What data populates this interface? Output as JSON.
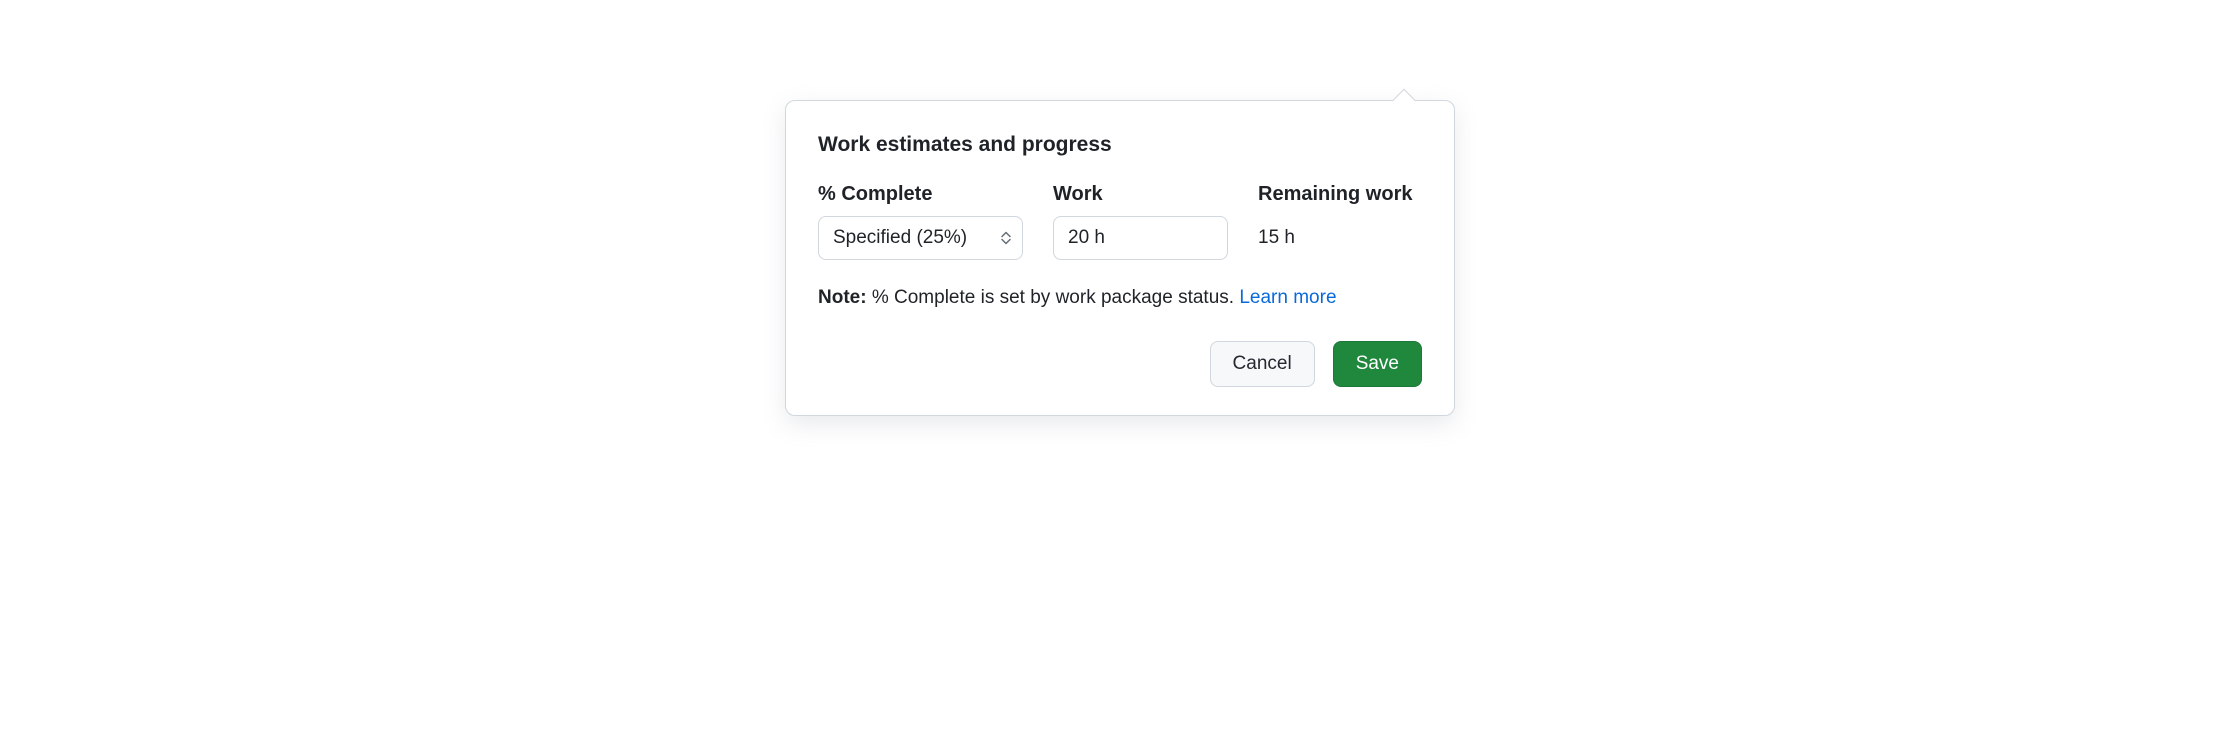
{
  "title": "Work estimates and progress",
  "fields": {
    "percent_complete": {
      "label": "% Complete",
      "value": "Specified (25%)"
    },
    "work": {
      "label": "Work",
      "value": "20 h"
    },
    "remaining_work": {
      "label": "Remaining work",
      "value": "15 h"
    }
  },
  "note": {
    "label": "Note:",
    "text": " % Complete is set by work package status. ",
    "learn_more": "Learn more"
  },
  "actions": {
    "cancel": "Cancel",
    "save": "Save"
  }
}
